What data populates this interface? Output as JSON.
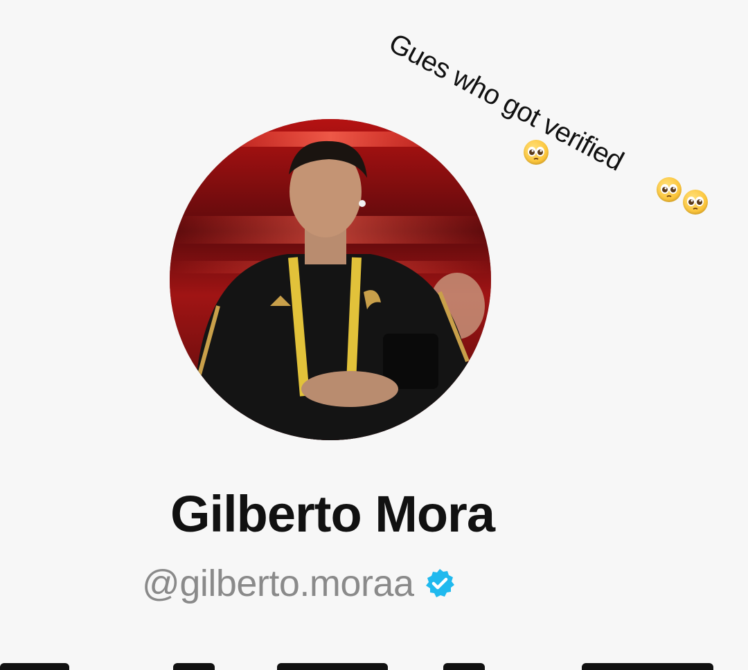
{
  "caption": {
    "text": "Gues who got verified",
    "emojis": [
      "pleading-face-emoji",
      "pleading-face-emoji",
      "pleading-face-emoji"
    ]
  },
  "profile": {
    "display_name": "Gilberto Mora",
    "handle": "@gilberto.moraa",
    "verified": true,
    "verified_color": "#20b9ee"
  },
  "colors": {
    "background": "#f7f7f7",
    "name": "#111111",
    "handle": "#8a8a8a",
    "avatar_bg": "#7a0d0f"
  }
}
